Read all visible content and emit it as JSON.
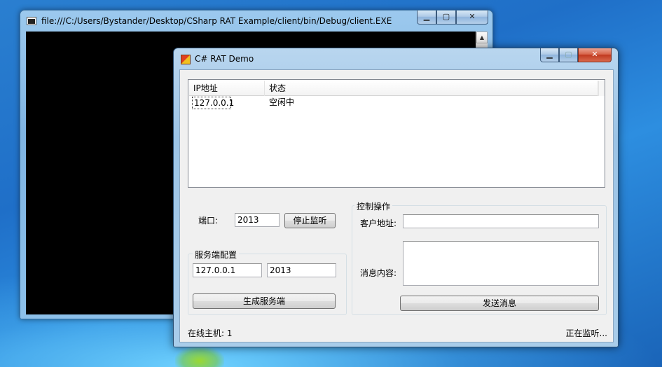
{
  "console_window": {
    "title": "file:///C:/Users/Bystander/Desktop/CSharp RAT Example/client/bin/Debug/client.EXE",
    "scroll_up_glyph": "▲",
    "caption": {
      "minimize": "▁",
      "maximize": "▢",
      "close": "✕"
    }
  },
  "demo_window": {
    "title": "C# RAT Demo",
    "caption": {
      "minimize": "▁",
      "maximize": "▢",
      "close": "✕"
    },
    "list": {
      "columns": [
        "IP地址",
        "状态"
      ],
      "rows": [
        {
          "ip": "127.0.0.1",
          "status": "空闲中"
        }
      ]
    },
    "port": {
      "label": "端口:",
      "value": "2013",
      "stop_button": "停止监听"
    },
    "server_config": {
      "title": "服务端配置",
      "ip_value": "127.0.0.1",
      "port_value": "2013",
      "generate_button": "生成服务端"
    },
    "control": {
      "title": "控制操作",
      "client_address_label": "客户地址:",
      "client_address_value": "",
      "message_label": "消息内容:",
      "message_value": "",
      "send_button": "发送消息"
    },
    "status": {
      "online_hosts": "在线主机: 1",
      "state": "正在监听..."
    }
  }
}
